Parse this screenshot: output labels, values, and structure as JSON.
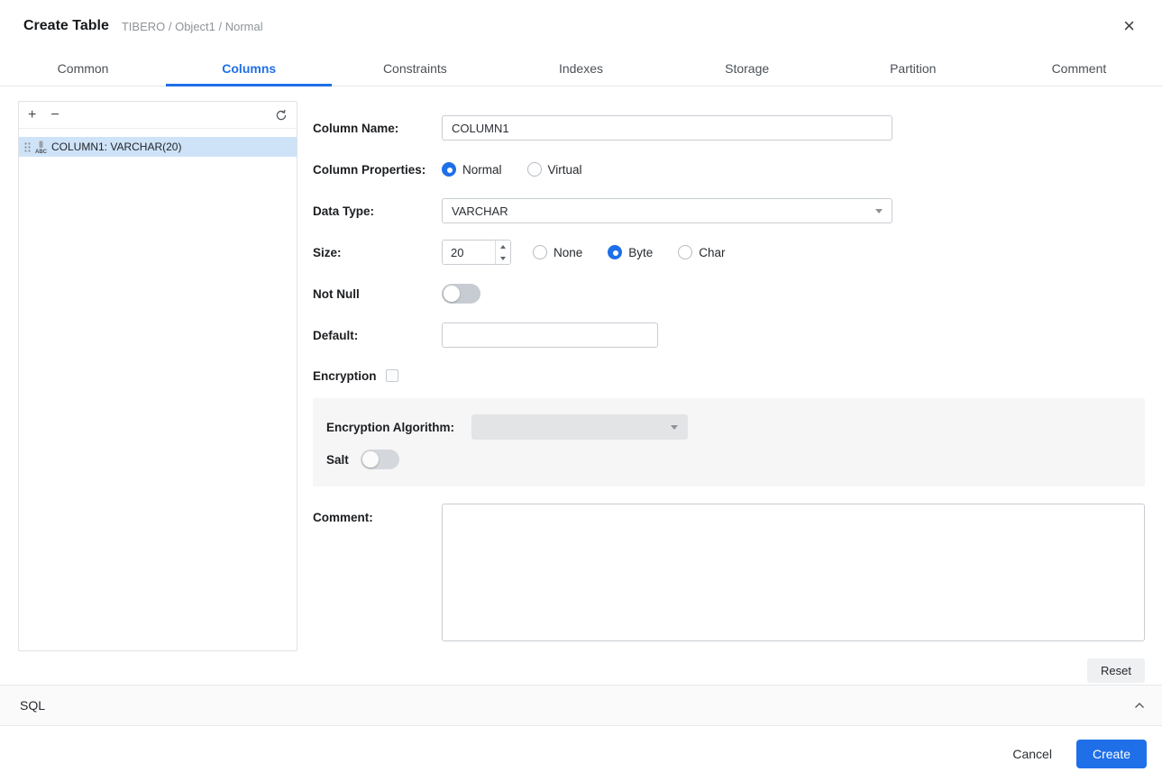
{
  "header": {
    "title": "Create Table",
    "breadcrumb": "TIBERO / Object1 / Normal",
    "close_icon": "×"
  },
  "tabs": [
    {
      "label": "Common",
      "active": false
    },
    {
      "label": "Columns",
      "active": true
    },
    {
      "label": "Constraints",
      "active": false
    },
    {
      "label": "Indexes",
      "active": false
    },
    {
      "label": "Storage",
      "active": false
    },
    {
      "label": "Partition",
      "active": false
    },
    {
      "label": "Comment",
      "active": false
    }
  ],
  "column_list": {
    "toolbar": {
      "add": "+",
      "remove": "−",
      "refresh_icon": "refresh"
    },
    "items": [
      {
        "label": "COLUMN1: VARCHAR(20)",
        "selected": true,
        "icons": [
          "drag-handle-icon",
          "string-column-icon"
        ]
      }
    ]
  },
  "form": {
    "column_name": {
      "label": "Column Name:",
      "value": "COLUMN1"
    },
    "column_properties": {
      "label": "Column Properties:",
      "options": [
        {
          "label": "Normal",
          "selected": true
        },
        {
          "label": "Virtual",
          "selected": false
        }
      ]
    },
    "data_type": {
      "label": "Data Type:",
      "value": "VARCHAR"
    },
    "size": {
      "label": "Size:",
      "value": "20",
      "unit_options": [
        {
          "label": "None",
          "selected": false
        },
        {
          "label": "Byte",
          "selected": true
        },
        {
          "label": "Char",
          "selected": false
        }
      ]
    },
    "not_null": {
      "label": "Not Null",
      "enabled": false
    },
    "default": {
      "label": "Default:",
      "value": ""
    },
    "encryption": {
      "label": "Encryption",
      "checked": false
    },
    "encryption_panel": {
      "algorithm_label": "Encryption Algorithm:",
      "algorithm_value": "",
      "salt_label": "Salt",
      "salt_enabled": false
    },
    "comment": {
      "label": "Comment:",
      "value": ""
    },
    "reset_button": "Reset"
  },
  "sql_section": {
    "label": "SQL",
    "collapse_icon": "chevron-up"
  },
  "footer": {
    "cancel_button": "Cancel",
    "create_button": "Create"
  },
  "colors": {
    "accent": "#1f6fe8",
    "selected_item_bg": "#cfe3f8",
    "panel_bg": "#f6f6f7"
  }
}
